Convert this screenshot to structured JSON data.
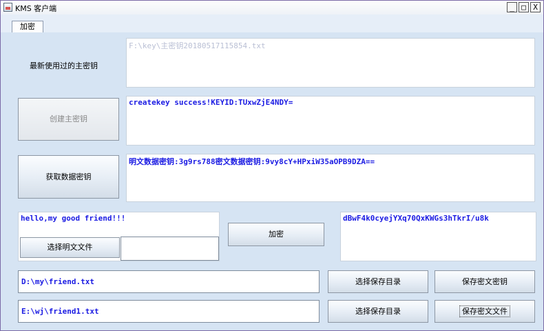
{
  "window": {
    "title": "KMS 客户端",
    "controls": {
      "minimize": "_",
      "maximize": "□",
      "close": "X"
    }
  },
  "tabs": [
    {
      "label": "加密",
      "selected": true
    }
  ],
  "master_key": {
    "recent_label": "最新使用过的主密钥",
    "recent_value": "F:\\key\\主密钥20180517115854.txt",
    "create_button": "创建主密钥",
    "create_result": "createkey success!KEYID:TUxwZjE4NDY="
  },
  "data_key": {
    "fetch_button": "获取数据密钥",
    "result": "明文数据密钥:3g9rs788密文数据密钥:9vy8cY+HPxiW35aOPB9DZA=="
  },
  "encrypt": {
    "plaintext": "hello,my good friend!!!",
    "choose_plain_file_button": "选择明文文件",
    "plain_file_value": "",
    "encrypt_button": "加密",
    "ciphertext": "dBwF4k0cyejYXq70QxKWGs3hTkrI/u8k"
  },
  "save": {
    "path1": "D:\\my\\friend.txt",
    "path2": "E:\\wj\\friend1.txt",
    "choose_dir_button_1": "选择保存目录",
    "choose_dir_button_2": "选择保存目录",
    "save_key_button": "保存密文密钥",
    "save_file_button": "保存密文文件"
  },
  "colors": {
    "panel": "#d6e4f3",
    "text_blue": "#1b1be3",
    "placeholder": "#b9bfd4"
  }
}
